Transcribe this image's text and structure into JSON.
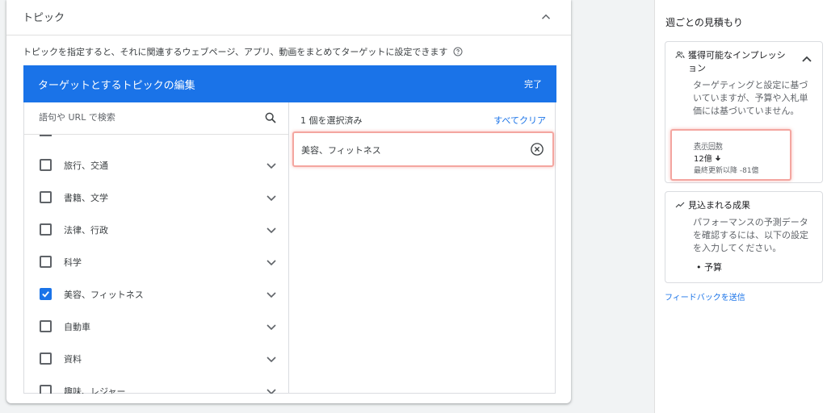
{
  "topic_card": {
    "title": "トピック",
    "description": "トピックを指定すると、それに関連するウェブページ、アプリ、動画をまとめてターゲットに設定できます",
    "editor": {
      "title": "ターゲットとするトピックの編集",
      "done_label": "完了",
      "search_placeholder": "語句や URL で検索",
      "items": [
        {
          "label": "旅行、交通",
          "checked": false
        },
        {
          "label": "書籍、文学",
          "checked": false
        },
        {
          "label": "法律、行政",
          "checked": false
        },
        {
          "label": "科学",
          "checked": false
        },
        {
          "label": "美容、フィットネス",
          "checked": true
        },
        {
          "label": "自動車",
          "checked": false
        },
        {
          "label": "資料",
          "checked": false
        },
        {
          "label": "趣味、レジャー",
          "checked": false
        }
      ],
      "selected_count": "1 個を選択済み",
      "clear_all": "すべてクリア",
      "selected_items": [
        "美容、フィットネス"
      ]
    }
  },
  "estimates": {
    "title": "週ごとの見積もり",
    "impressions_box": {
      "title": "獲得可能なインプレッション",
      "description": "ターゲティングと設定に基づいていますが、予算や入札単価には基づいていません。",
      "metric_label": "表示回数",
      "metric_value": "12億",
      "metric_arrow": "down",
      "metric_change": "最終更新以降 -81億"
    },
    "results_box": {
      "title": "見込まれる成果",
      "description": "パフォーマンスの予測データを確認するには、以下の設定を入力してください。",
      "bullet": "予算"
    },
    "feedback_link": "フィードバックを送信"
  },
  "colors": {
    "accent": "#1a73e8",
    "highlight": "#f4a6a0"
  }
}
